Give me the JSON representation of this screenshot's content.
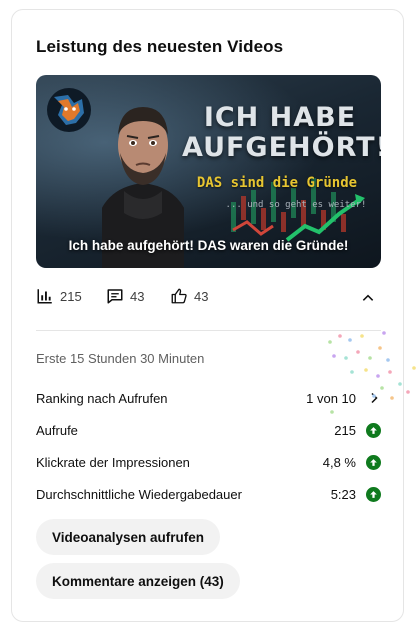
{
  "card": {
    "title": "Leistung des neuesten Videos"
  },
  "thumbnail": {
    "headline_line1": "ICH HABE",
    "headline_line2": "AUFGEHÖRT!",
    "subheadline": "DAS sind die Gründe",
    "small_text": "... und so geht es weiter!",
    "caption": "Ich habe aufgehört! DAS waren die Gründe!"
  },
  "stats": {
    "views": "215",
    "comments": "43",
    "likes": "43"
  },
  "period": "Erste 15 Stunden 30 Minuten",
  "metrics": [
    {
      "label": "Ranking nach Aufrufen",
      "value": "1 von 10",
      "indicator": "chevron-right-icon"
    },
    {
      "label": "Aufrufe",
      "value": "215",
      "indicator": "arrow-up-icon"
    },
    {
      "label": "Klickrate der Impressionen",
      "value": "4,8 %",
      "indicator": "arrow-up-icon"
    },
    {
      "label": "Durchschnittliche Wiedergabedauer",
      "value": "5:23",
      "indicator": "arrow-up-icon"
    }
  ],
  "buttons": {
    "analytics": "Videoanalysen aufrufen",
    "comments": "Kommentare anzeigen (43)"
  },
  "colors": {
    "up_indicator": "#0f7a1e",
    "button_bg": "#f2f2f2",
    "accent_yellow": "#e7c531"
  }
}
